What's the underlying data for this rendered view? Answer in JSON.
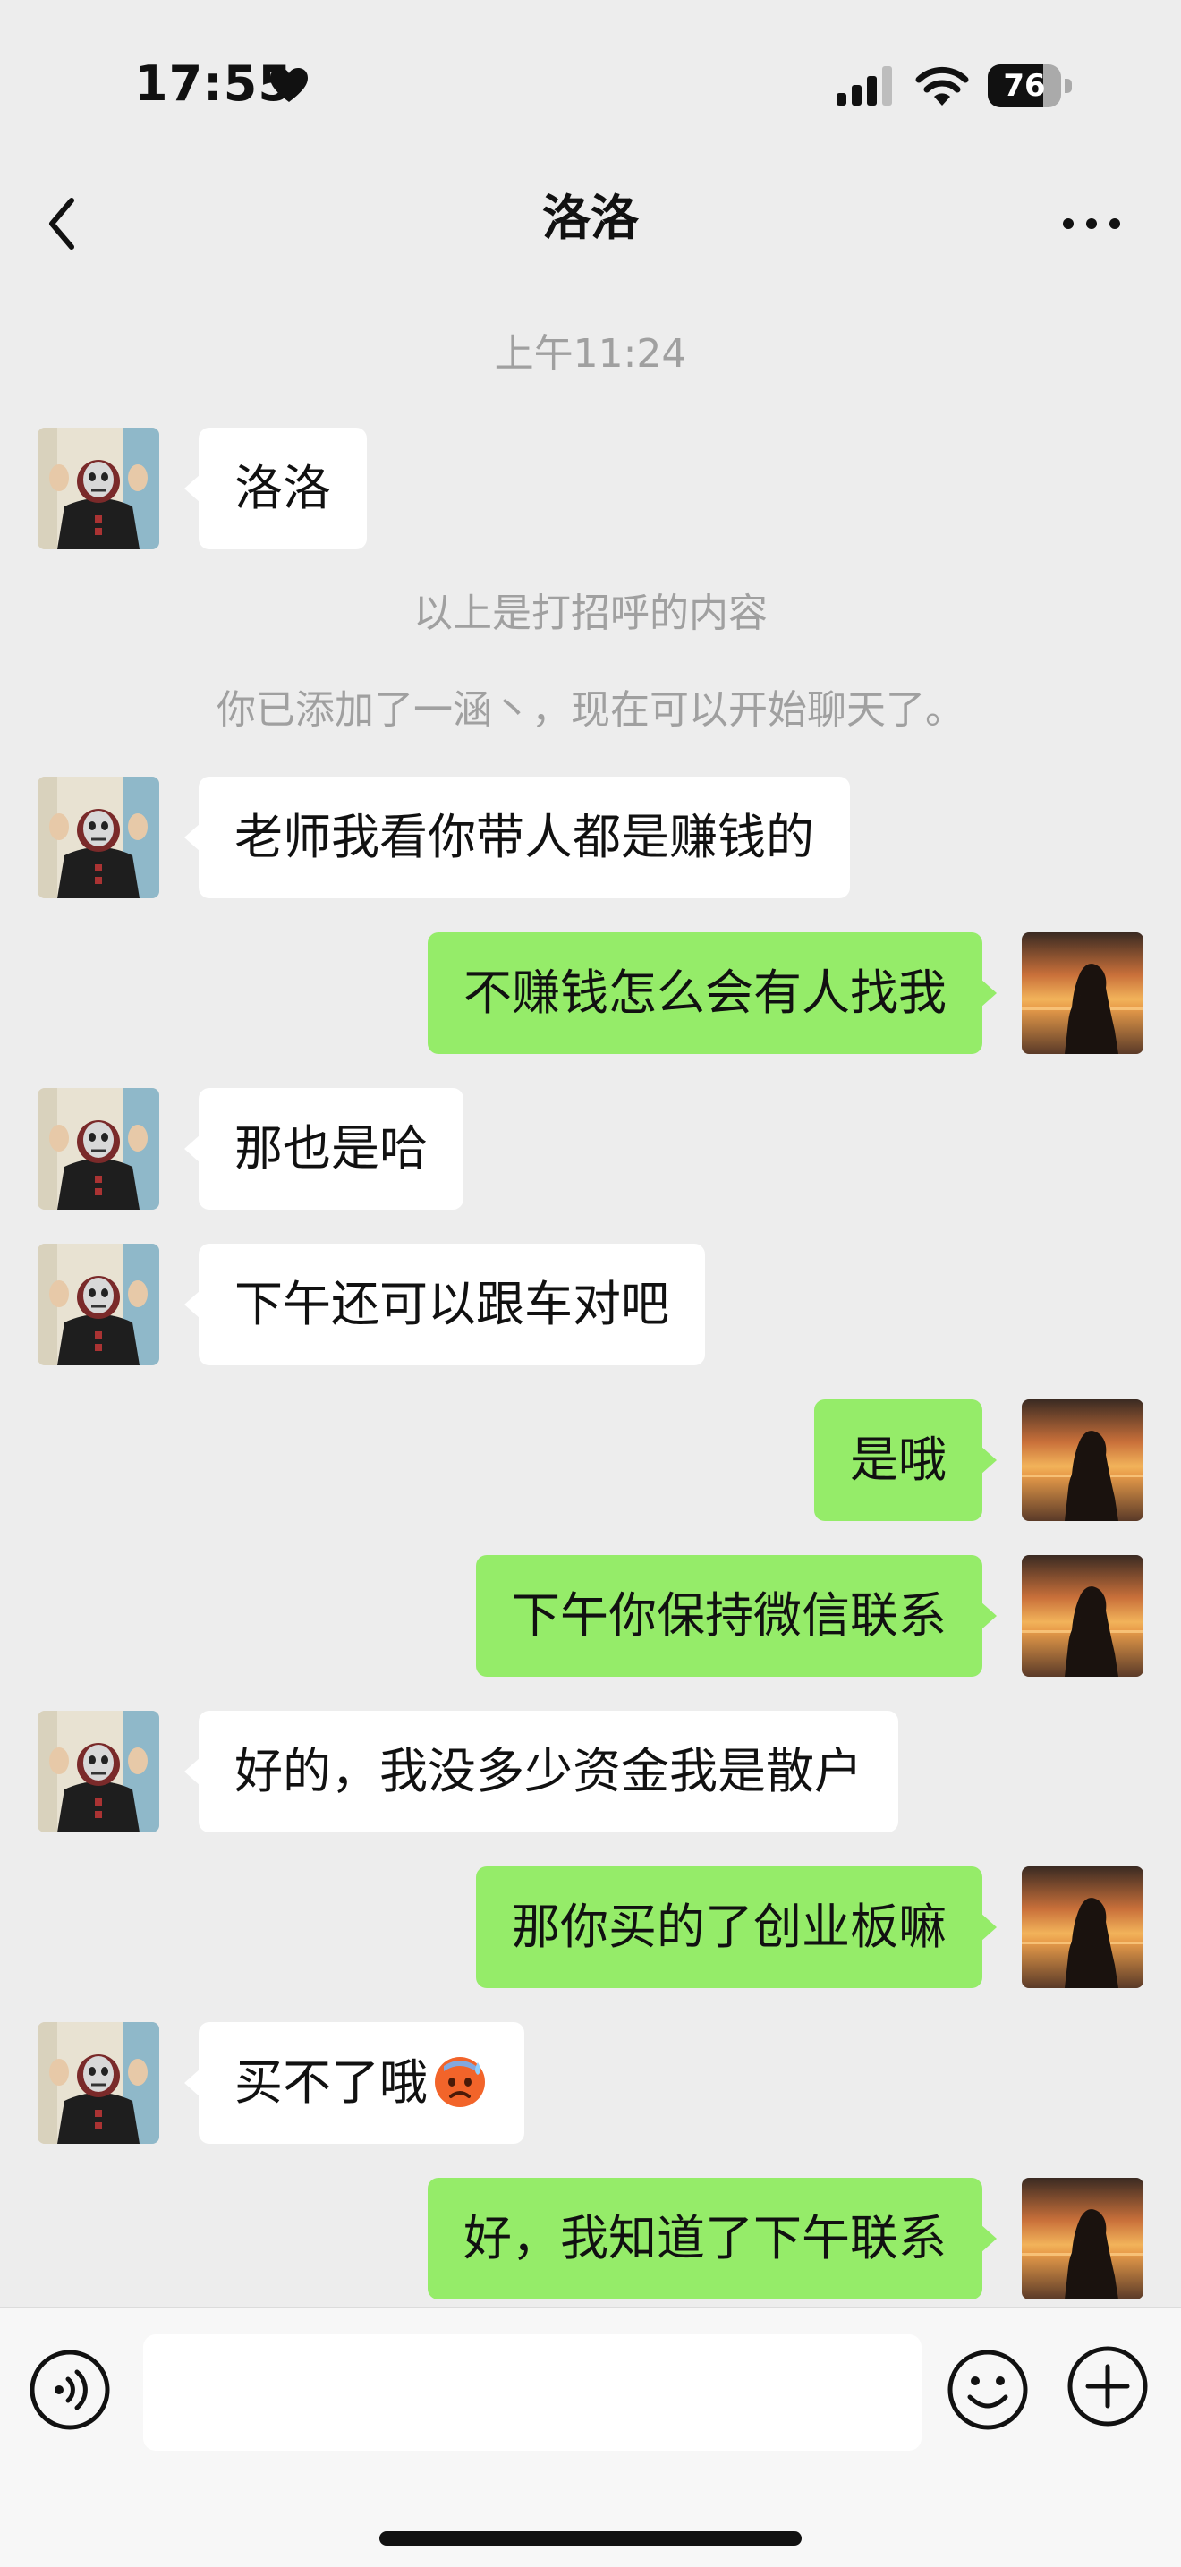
{
  "status_bar": {
    "time": "17:55",
    "battery_level": "76",
    "battery_fraction": 0.76
  },
  "header": {
    "title": "洛洛"
  },
  "chat": {
    "timestamp": "上午11:24",
    "system_notes": [
      "以上是打招呼的内容",
      "你已添加了一涵丶，现在可以开始聊天了。"
    ],
    "messages": [
      {
        "side": "left",
        "text": "洛洛"
      },
      {
        "side": "left",
        "text": "老师我看你带人都是赚钱的"
      },
      {
        "side": "right",
        "text": "不赚钱怎么会有人找我"
      },
      {
        "side": "left",
        "text": "那也是哈"
      },
      {
        "side": "left",
        "text": "下午还可以跟车对吧"
      },
      {
        "side": "right",
        "text": "是哦"
      },
      {
        "side": "right",
        "text": "下午你保持微信联系"
      },
      {
        "side": "left",
        "text": "好的，我没多少资金我是散户"
      },
      {
        "side": "right",
        "text": "那你买的了创业板嘛"
      },
      {
        "side": "left",
        "text": "买不了哦"
      },
      {
        "side": "right",
        "text": "好，我知道了下午联系"
      }
    ]
  },
  "input_bar": {
    "placeholder": ""
  },
  "icons": {
    "back": "chevron-left-icon",
    "more": "more-dots-icon",
    "voice": "voice-icon",
    "emoji": "smiley-icon",
    "plus": "plus-circle-icon",
    "sweat_emoji": "anxious-sweat-emoji-icon"
  },
  "colors": {
    "background": "#ededed",
    "bubble_self": "#95ec69",
    "bubble_other": "#ffffff",
    "system_text": "#a0a0a0"
  }
}
